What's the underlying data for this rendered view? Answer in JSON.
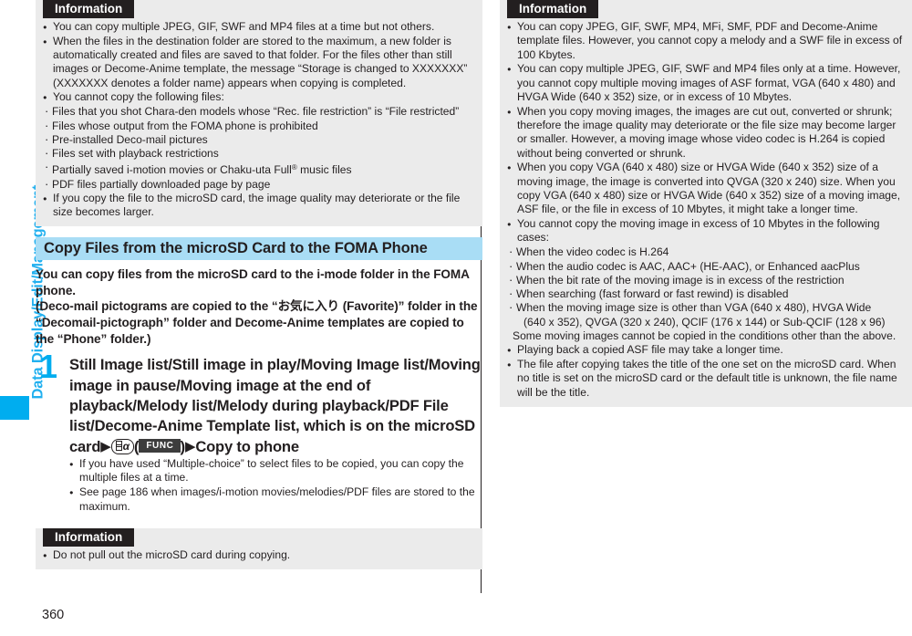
{
  "page": {
    "number": "360",
    "side_tab": "Data Display/Edit/Management"
  },
  "left_column": {
    "info_box_top": {
      "title": "Information",
      "bullets": [
        "You can copy multiple JPEG, GIF, SWF and MP4 files at a time but not others.",
        "When the files in the destination folder are stored to the maximum, a new folder is automatically created and files are saved to that folder. For the files other than still images or Decome-Anime template, the message “Storage is changed to XXXXXXX” (XXXXXXX denotes a folder name) appears when copying is completed.",
        "You cannot copy the following files:",
        "If you copy the file to the microSD card, the image quality may deteriorate or the file size becomes larger."
      ],
      "sub_items": [
        "Files that you shot Chara-den models whose “Rec. file restriction” is “File restricted”",
        "Files whose output from the FOMA phone is prohibited",
        "Pre-installed Deco-mail pictures",
        "Files set with playback restrictions",
        "Partially saved i-motion movies or Chaku-uta Full® music files",
        "PDF files partially downloaded page by page"
      ]
    },
    "section_heading": "Copy Files from the microSD Card to the FOMA Phone",
    "intro_lines": [
      "You can copy files from the microSD card to the i-mode folder in the FOMA phone.",
      "(Deco-mail pictograms are copied to the “お気に入り (Favorite)” folder in the “Decomail-pictograph” folder and Decome-Anime templates are copied to the “Phone” folder.)"
    ],
    "step": {
      "number": "1",
      "text_before_key": "Still Image list/Still image in play/Moving Image list/Moving image in pause/Moving image at the end of playback/Melody list/Melody during playback/PDF File list/Decome-Anime Template list, which is on the microSD card",
      "key_icon_name": "imode-func-key-icon",
      "func_chip_label": "FUNC",
      "text_after_key": "Copy to phone",
      "notes": [
        "If you have used “Multiple-choice” to select files to be copied, you can copy the multiple files at a time.",
        "See page 186 when images/i-motion movies/melodies/PDF files are stored to the maximum."
      ]
    },
    "info_box_bottom": {
      "title": "Information",
      "bullets": [
        "Do not pull out the microSD card during copying."
      ]
    }
  },
  "right_column": {
    "info_box": {
      "title": "Information",
      "bullets": [
        "You can copy JPEG, GIF, SWF, MP4, MFi, SMF, PDF and Decome-Anime template files. However, you cannot copy a melody and a SWF file in excess of 100 Kbytes.",
        "You can copy multiple JPEG, GIF, SWF and MP4 files only at a time. However, you cannot copy multiple moving images of ASF format, VGA (640 x 480) and HVGA Wide (640 x 352) size, or in excess of 10 Mbytes.",
        "When you copy moving images, the images are cut out, converted or shrunk; therefore the image quality may deteriorate or the file size may become larger or smaller. However, a moving image whose video codec is H.264 is copied without being converted or shrunk.",
        "When you copy VGA (640 x 480) size or HVGA Wide (640 x 352) size of a moving image, the image is converted into QVGA (320 x 240) size. When you copy VGA (640 x 480) size or HVGA Wide (640 x 352) size of a moving image, ASF file, or the file in excess of 10 Mbytes, it might take a longer time.",
        "You cannot copy the moving image in excess of 10 Mbytes in the following cases:",
        "Playing back a copied ASF file may take a longer time.",
        "The file after copying takes the title of the one set on the microSD card. When no title is set on the microSD card or the default title is unknown, the file name will be the title."
      ],
      "sub_items": [
        "When the video codec is H.264",
        "When the audio codec is AAC, AAC+ (HE-AAC), or Enhanced aacPlus",
        "When the bit rate of the moving image is in excess of the restriction",
        "When searching (fast forward or fast rewind) is disabled",
        "When the moving image size is other than VGA (640 x 480), HVGA Wide"
      ],
      "sub_item_continuation": "(640 x 352), QVGA (320 x 240), QCIF (176 x 144) or Sub-QCIF (128 x 96)",
      "sub_items_footer": "Some moving images cannot be copied in the conditions other than the above."
    }
  }
}
